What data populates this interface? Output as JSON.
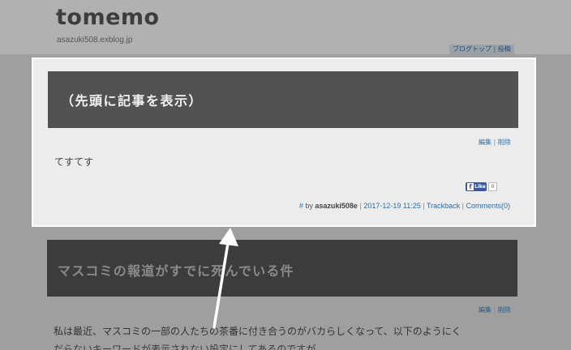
{
  "header": {
    "site_title": "tomemo",
    "site_url": "asazuki508.exblog.jp",
    "nav": {
      "blog_top": "ブログトップ",
      "separator": "|",
      "post": "投稿"
    }
  },
  "post1": {
    "title": "（先頭に記事を表示）",
    "edit": "編集",
    "edit_sep": "|",
    "delete": "削除",
    "body": "てすてす",
    "like_label": "Like",
    "like_count": "0",
    "meta": {
      "hash": "#",
      "by": "by",
      "author": "asazuki508e",
      "sep": "|",
      "datetime": "2017-12-19 11:25",
      "trackback": "Trackback",
      "comments": "Comments(0)"
    }
  },
  "post2": {
    "title": "マスコミの報道がすでに死んでいる件",
    "edit": "編集",
    "edit_sep": "|",
    "delete": "削除",
    "body_line1": "私は最近、マスコミの一部の人たちの茶番に付き合うのがバカらしくなって、以下のようにく",
    "body_line2": "だらないキーワードが表示されない設定にしてあるのですが"
  },
  "colors": {
    "accent_link": "#2a6fa8",
    "title_bar": "#525252",
    "overlay_bg": "#9f9f9f",
    "highlight": "#ffffff"
  }
}
